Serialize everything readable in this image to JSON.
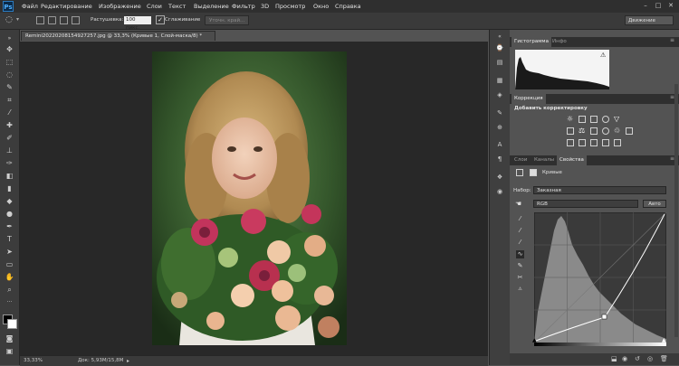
{
  "app": {
    "logo": "Ps"
  },
  "menu": [
    "Файл",
    "Редактирование",
    "Изображение",
    "Слои",
    "Текст",
    "Выделение",
    "Фильтр",
    "3D",
    "Просмотр",
    "Окно",
    "Справка"
  ],
  "window_controls": {
    "minimize": "–",
    "maximize": "□",
    "close": "✕"
  },
  "options": {
    "feather_label": "Растушевка:",
    "feather_value": "100 пикс.",
    "antialias_label": "Сглаживание",
    "refine_edge": "Уточн. край...",
    "workspace": "Движение"
  },
  "document": {
    "tab_title": "Remini20220208154927257.jpg @ 33,3% (Кривые 1, Слой-маска/8) *",
    "zoom": "33,33%",
    "doc_size": "Док: 5,93M/15,8M"
  },
  "panels": {
    "histogram_tabs": [
      "Гистограмма",
      "Инфо"
    ],
    "corrections_tab": "Коррекция",
    "add_correction": "Добавить корректировку",
    "layer_tabs": [
      "Слои",
      "Каналы",
      "Свойства"
    ],
    "curves_title": "Кривые",
    "preset_label": "Набор:",
    "preset_value": "Заказная",
    "channel_value": "RGB",
    "auto_button": "Авто"
  },
  "colors": {
    "accent": "#f3a23a",
    "panel": "#535353",
    "dark": "#282828"
  }
}
